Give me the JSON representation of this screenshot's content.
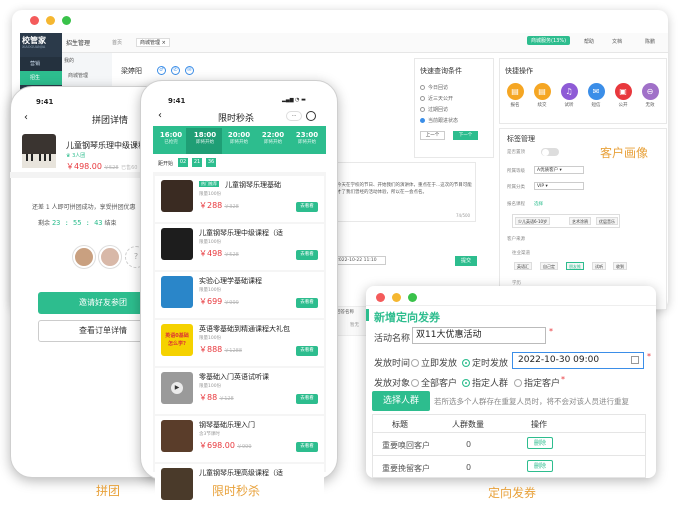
{
  "backWindow": {
    "logo": "校管家",
    "logoSub": "XIAOGUANJIA",
    "breadcrumb": "招生管理",
    "tabs": [
      "首页",
      "商城管理"
    ],
    "sidebarItems": [
      "营销",
      "招生"
    ],
    "nav2": [
      "我的",
      "商城管理"
    ],
    "topStatus": "商城服务(13%)",
    "topRight": [
      "帮助",
      "文档",
      "陈鹏"
    ],
    "studentName": "梁婷阳",
    "quickQuery": {
      "title": "快速查询条件",
      "options": [
        "今日回访",
        "近三天公开",
        "过期回访",
        "当前跟进状态"
      ],
      "prev": "上一个",
      "next": "下一个"
    },
    "quickActions": {
      "title": "快捷操作",
      "items": [
        {
          "label": "报名",
          "color": "#f5a623",
          "icon": "clipboard-icon"
        },
        {
          "label": "续交",
          "color": "#f5a623",
          "icon": "clipboard-icon"
        },
        {
          "label": "试听",
          "color": "#8e5bd6",
          "icon": "headphones-icon"
        },
        {
          "label": "短信",
          "color": "#3b8ee8",
          "icon": "mail-icon"
        },
        {
          "label": "公开",
          "color": "#e8383d",
          "icon": "bag-icon"
        },
        {
          "label": "无效",
          "color": "#a070c8",
          "icon": "minus-icon"
        }
      ]
    },
    "tagMgmt": {
      "title": "标签管理",
      "fields": [
        {
          "label": "是否置顶",
          "value": ""
        },
        {
          "label": "所属等级",
          "value": "A优质客户"
        },
        {
          "label": "所属分类",
          "value": "VIP"
        },
        {
          "label": "报名课程",
          "value": "选择"
        }
      ],
      "courseTags": [
        "少儿英语6-10岁",
        "艺术涂鸦",
        "优层音乐"
      ],
      "sourceLabel": "客户来源",
      "channelLabel": "往业渠道",
      "channels": [
        "英语汇",
        "自己定",
        "朋友推",
        "试听",
        "收到"
      ],
      "studyLabel": "学历"
    },
    "messageText": "今天在学校的节日、开始我们的演讲体，重点在于...这次的节目可能才了我们曾经的活动体验，所以在一会点名。",
    "charCount": "74/500",
    "date": "2022-10-22 11:10",
    "submit": "提交",
    "tableHeader": "回答名称",
    "tableRow": "暂无"
  },
  "captions": {
    "portrait": "客户画像",
    "group": "拼团",
    "flash": "限时秒杀",
    "targeted": "定向发券"
  },
  "phone1": {
    "time": "9:41",
    "title": "拼团详情",
    "productName": "儿童钢琴乐理中级课程",
    "joined": "3人团",
    "price": "￥498.00",
    "original": "￥528",
    "sold": "已售60",
    "lackText": "还差 1 人即可拼团成功，享受拼团优惠",
    "countdownLabel": "剩余",
    "countdown": "23 : 55 : 43",
    "countdownSuffix": "结束",
    "inviteButton": "邀请好友参团",
    "orderButton": "查看订单详情",
    "avatarPlaceholder": "?"
  },
  "phone2": {
    "time": "9:41",
    "title": "限时秒杀",
    "tabs": [
      {
        "time": "16:00",
        "status": "已抢完"
      },
      {
        "time": "18:00",
        "status": "即将开始"
      },
      {
        "time": "20:00",
        "status": "即将开始"
      },
      {
        "time": "22:00",
        "status": "即将开始"
      },
      {
        "time": "23:00",
        "status": "即将开始"
      }
    ],
    "countdownLabel": "距开始",
    "countdown": [
      "02",
      "21",
      "36"
    ],
    "goLabel": "去看看",
    "products": [
      {
        "badge": "热门推荐",
        "name": "儿童钢琴乐理基础",
        "meta": "限量100份",
        "price": "￥288",
        "original": "￥328"
      },
      {
        "badge": "",
        "name": "儿童钢琴乐理中级课程（适",
        "meta": "限量100份",
        "price": "￥498",
        "original": "￥528"
      },
      {
        "badge": "",
        "name": "实验心理学基础课程",
        "meta": "限量100份",
        "price": "￥699",
        "original": "￥999"
      },
      {
        "badge": "",
        "name": "英语零基础到精通课程大礼包",
        "meta": "限量100份",
        "price": "￥888",
        "original": "￥1288"
      },
      {
        "badge": "",
        "name": "零基础入门英语试听课",
        "meta": "限量100份",
        "price": "￥88",
        "original": "￥128"
      },
      {
        "badge": "",
        "name": "钢琴基础乐理入门",
        "meta": "含3节课时",
        "price": "￥698.00",
        "original": "￥999"
      },
      {
        "badge": "",
        "name": "儿童钢琴乐理高级课程（适",
        "meta": "",
        "price": "",
        "original": ""
      }
    ],
    "thumbTexts": [
      "英语0基础",
      "怎么学?"
    ]
  },
  "dialog": {
    "title": "新增定向发券",
    "nameLabel": "活动名称",
    "nameValue": "双11大优惠活动",
    "timeLabel": "发放时间",
    "timeOptions": [
      "立即发放",
      "定时发放"
    ],
    "dateValue": "2022-10-30 09:00",
    "targetLabel": "发放对象",
    "targetOptions": [
      "全部客户",
      "指定人群",
      "指定客户"
    ],
    "selectButton": "选择人群",
    "notice": "若所选多个人群存在重复人员时，将不会对该人员进行重复",
    "columns": [
      "标题",
      "人群数量",
      "操作"
    ],
    "rows": [
      {
        "title": "重要唤回客户",
        "count": "0",
        "action": "删除"
      },
      {
        "title": "重要挽留客户",
        "count": "0",
        "action": "删除"
      }
    ]
  },
  "colors": {
    "green": "#2dbd8e",
    "price": "#e8383d",
    "caption": "#e8a13a"
  }
}
